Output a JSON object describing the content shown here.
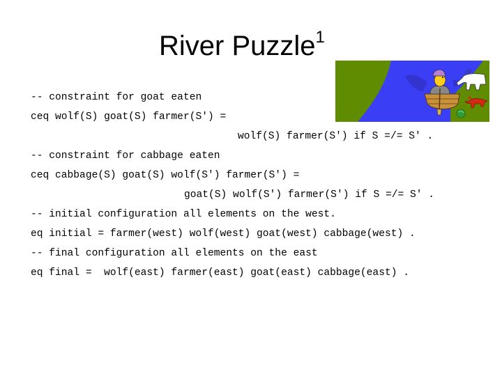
{
  "slide": {
    "title": "River Puzzle",
    "title_superscript": "1"
  },
  "illustration": {
    "description": "Farmer rowing a boat across a river, with a goat, a wolf and a cabbage on the far bank",
    "colors": {
      "grass": "#5f8c00",
      "river": "#3a3ef5",
      "boat": "#c8913a",
      "farmer_hat": "#b77fd6",
      "farmer_face": "#ffcc1a",
      "wolf": "#d42a14",
      "goat": "#ffffff",
      "cabbage": "#2f9b39"
    }
  },
  "code": {
    "lines": [
      "-- constraint for goat eaten",
      "ceq wolf(S) goat(S) farmer(S') =",
      "wolf(S) farmer(S') if S =/= S' .",
      "-- constraint for cabbage eaten",
      "ceq cabbage(S) goat(S) wolf(S') farmer(S') =",
      "goat(S) wolf(S') farmer(S') if S =/= S' .",
      "-- initial configuration all elements on the west.",
      "eq initial = farmer(west) wolf(west) goat(west) cabbage(west) .",
      "-- final configuration all elements on the east",
      "eq final =  wolf(east) farmer(east) goat(east) cabbage(east) ."
    ]
  }
}
